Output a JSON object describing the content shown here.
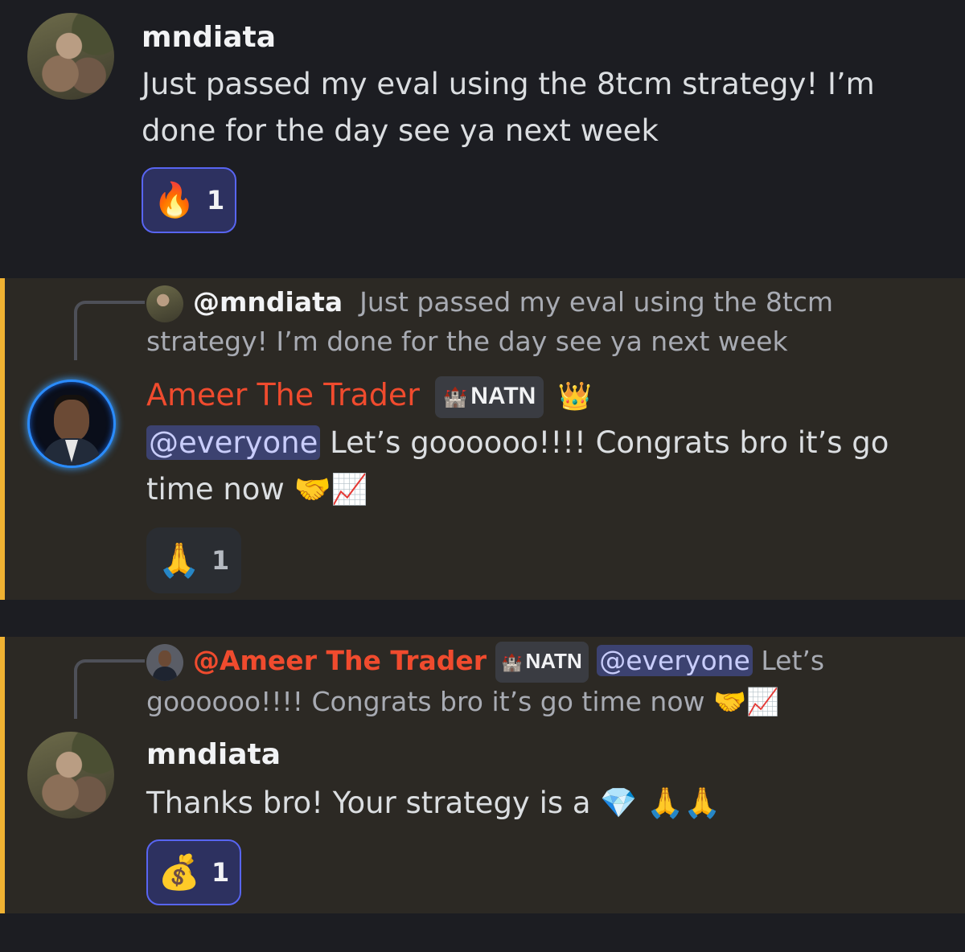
{
  "messages": [
    {
      "author": "mndiata",
      "text": "Just passed my eval using the 8tcm strategy! I’m done for the day see ya next week",
      "reaction": {
        "emoji": "🔥",
        "count": "1"
      }
    },
    {
      "reply_to": {
        "author": "@mndiata",
        "text": "Just passed my eval using the 8tcm strategy! I’m done for the day see ya next week"
      },
      "author": "Ameer The Trader",
      "tag": "NATN",
      "tag_icon": "🏰",
      "badge": "👑",
      "mention": "@everyone",
      "text": "Let’s goooooo!!!! Congrats bro it’s go time now",
      "emojis": "🤝📈",
      "reaction": {
        "emoji": "🙏",
        "count": "1"
      }
    },
    {
      "reply_to": {
        "author": "@Ameer The Trader",
        "tag": "NATN",
        "mention": "@everyone",
        "text": "Let’s goooooo!!!! Congrats bro it’s go time now",
        "emojis": "🤝📈"
      },
      "author": "mndiata",
      "text": "Thanks bro!  Your strategy is a",
      "emojis": "💎 🙏🙏",
      "reaction": {
        "emoji": "💰",
        "count": "1"
      }
    }
  ],
  "colors": {
    "background": "#1c1d22",
    "highlight_bg": "#2c2924",
    "highlight_bar": "#f0b232",
    "ameer_name": "#f04b2e",
    "mention_bg": "#3c4270",
    "reaction_active_border": "#5865f2"
  }
}
